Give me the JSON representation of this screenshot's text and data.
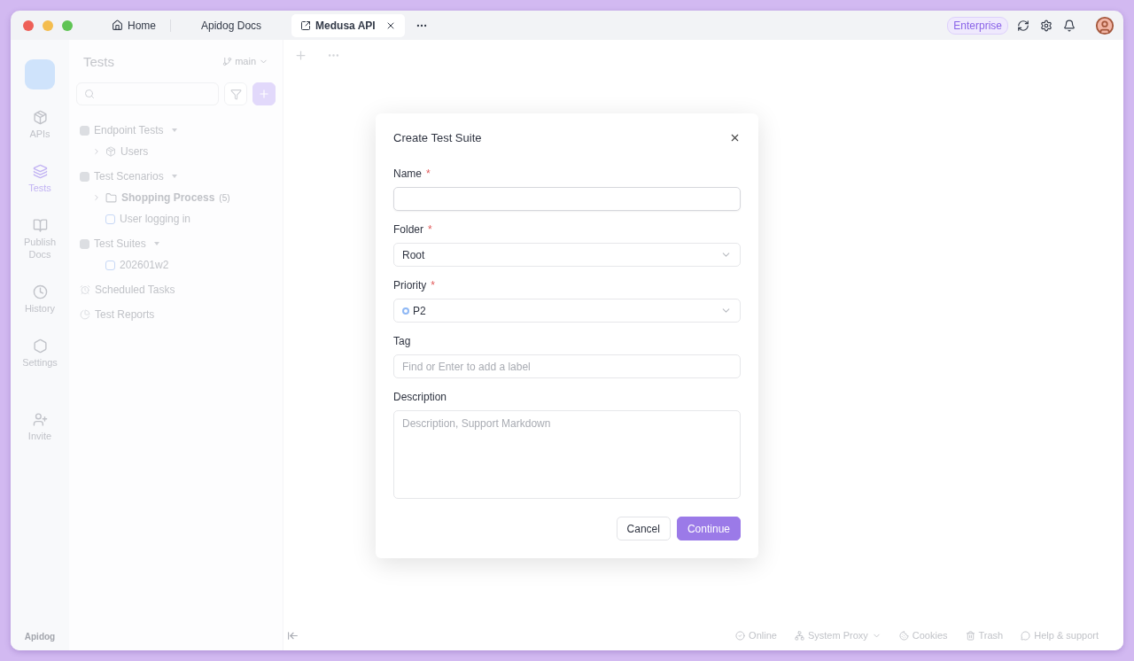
{
  "window": {
    "tabs": [
      {
        "label": "Home",
        "selected": false
      },
      {
        "label": "Apidog Docs",
        "selected": false
      },
      {
        "label": "Medusa API",
        "selected": true
      }
    ],
    "plan_badge": "Enterprise"
  },
  "rail": {
    "items": [
      {
        "label": "APIs",
        "selected": false
      },
      {
        "label": "Tests",
        "selected": true
      },
      {
        "label": "Publish Docs",
        "selected": false
      },
      {
        "label": "History",
        "selected": false
      },
      {
        "label": "Settings",
        "selected": false
      },
      {
        "label": "Invite",
        "selected": false
      }
    ],
    "brand": "Apidog"
  },
  "panel": {
    "title": "Tests",
    "branch": "main",
    "tree": [
      {
        "label": "Endpoint Tests",
        "kind": "endpoint",
        "expanded": true,
        "children": [
          {
            "label": "Users",
            "kind": "module",
            "expanded": false
          }
        ]
      },
      {
        "label": "Test Scenarios",
        "kind": "scenarios",
        "expanded": true,
        "children": [
          {
            "label": "Shopping Process",
            "kind": "folder",
            "count": "(5)",
            "expanded": false
          },
          {
            "label": "User logging in",
            "kind": "scenario"
          }
        ]
      },
      {
        "label": "Test Suites",
        "kind": "suites",
        "expanded": true,
        "children": [
          {
            "label": "202601w2",
            "kind": "suite"
          }
        ]
      },
      {
        "label": "Scheduled Tasks",
        "kind": "scheduled"
      },
      {
        "label": "Test Reports",
        "kind": "reports"
      }
    ]
  },
  "dialog": {
    "title": "Create Test Suite",
    "fields": [
      {
        "label": "Name",
        "kind": "text",
        "required_mark": "*"
      },
      {
        "label": "Folder",
        "kind": "select",
        "required_mark": "*",
        "value": "Root"
      },
      {
        "label": "Priority",
        "kind": "select",
        "required_mark": "*",
        "value": "P2",
        "color": "#8fb8f5"
      },
      {
        "label": "Tag",
        "kind": "text",
        "placeholder": "Find or Enter to add a label"
      },
      {
        "label": "Description",
        "kind": "textarea",
        "placeholder": "Description, Support Markdown"
      }
    ],
    "buttons": [
      {
        "label": "Cancel",
        "primary": false
      },
      {
        "label": "Continue",
        "primary": true
      }
    ]
  },
  "status_bar": {
    "items": [
      {
        "label": "Online",
        "dropdown": false
      },
      {
        "label": "System Proxy",
        "dropdown": true
      },
      {
        "label": "Cookies",
        "dropdown": false
      },
      {
        "label": "Trash",
        "dropdown": false
      },
      {
        "label": "Help & support",
        "dropdown": false
      }
    ]
  }
}
